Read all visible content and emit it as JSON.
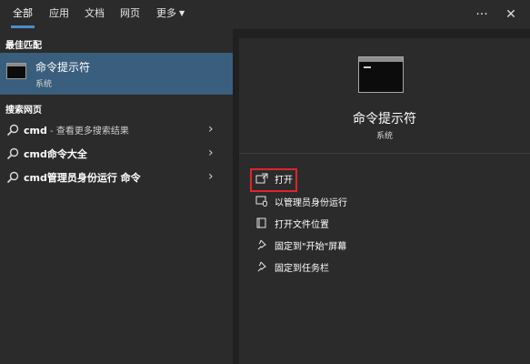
{
  "tabs": [
    {
      "label": "全部",
      "active": true
    },
    {
      "label": "应用"
    },
    {
      "label": "文档"
    },
    {
      "label": "网页"
    },
    {
      "label": "更多"
    }
  ],
  "topbar_icons": [
    "more-options-icon",
    "close-icon"
  ],
  "left": {
    "best_match_header": "最佳匹配",
    "best_match": {
      "title": "命令提示符",
      "subtitle": "系统",
      "icon": "command-prompt-icon"
    },
    "web_header": "搜索网页",
    "web_results": [
      {
        "bold": "cmd",
        "hint": " - 查看更多搜索结果"
      },
      {
        "bold": "cmd命令大全",
        "hint": ""
      },
      {
        "bold": "cmd管理员身份运行 命令",
        "hint": ""
      }
    ]
  },
  "right": {
    "app_title": "命令提示符",
    "app_subtitle": "系统",
    "actions": [
      {
        "label": "打开",
        "icon": "open-icon"
      },
      {
        "label": "以管理员身份运行",
        "icon": "run-as-admin-icon"
      },
      {
        "label": "打开文件位置",
        "icon": "file-location-icon"
      },
      {
        "label": "固定到\"开始\"屏幕",
        "icon": "pin-icon"
      },
      {
        "label": "固定到任务栏",
        "icon": "pin-icon"
      }
    ]
  },
  "colors": {
    "accent": "#4f8cc9",
    "selection": "#3a5e7d",
    "highlight_box": "#e0242b"
  }
}
